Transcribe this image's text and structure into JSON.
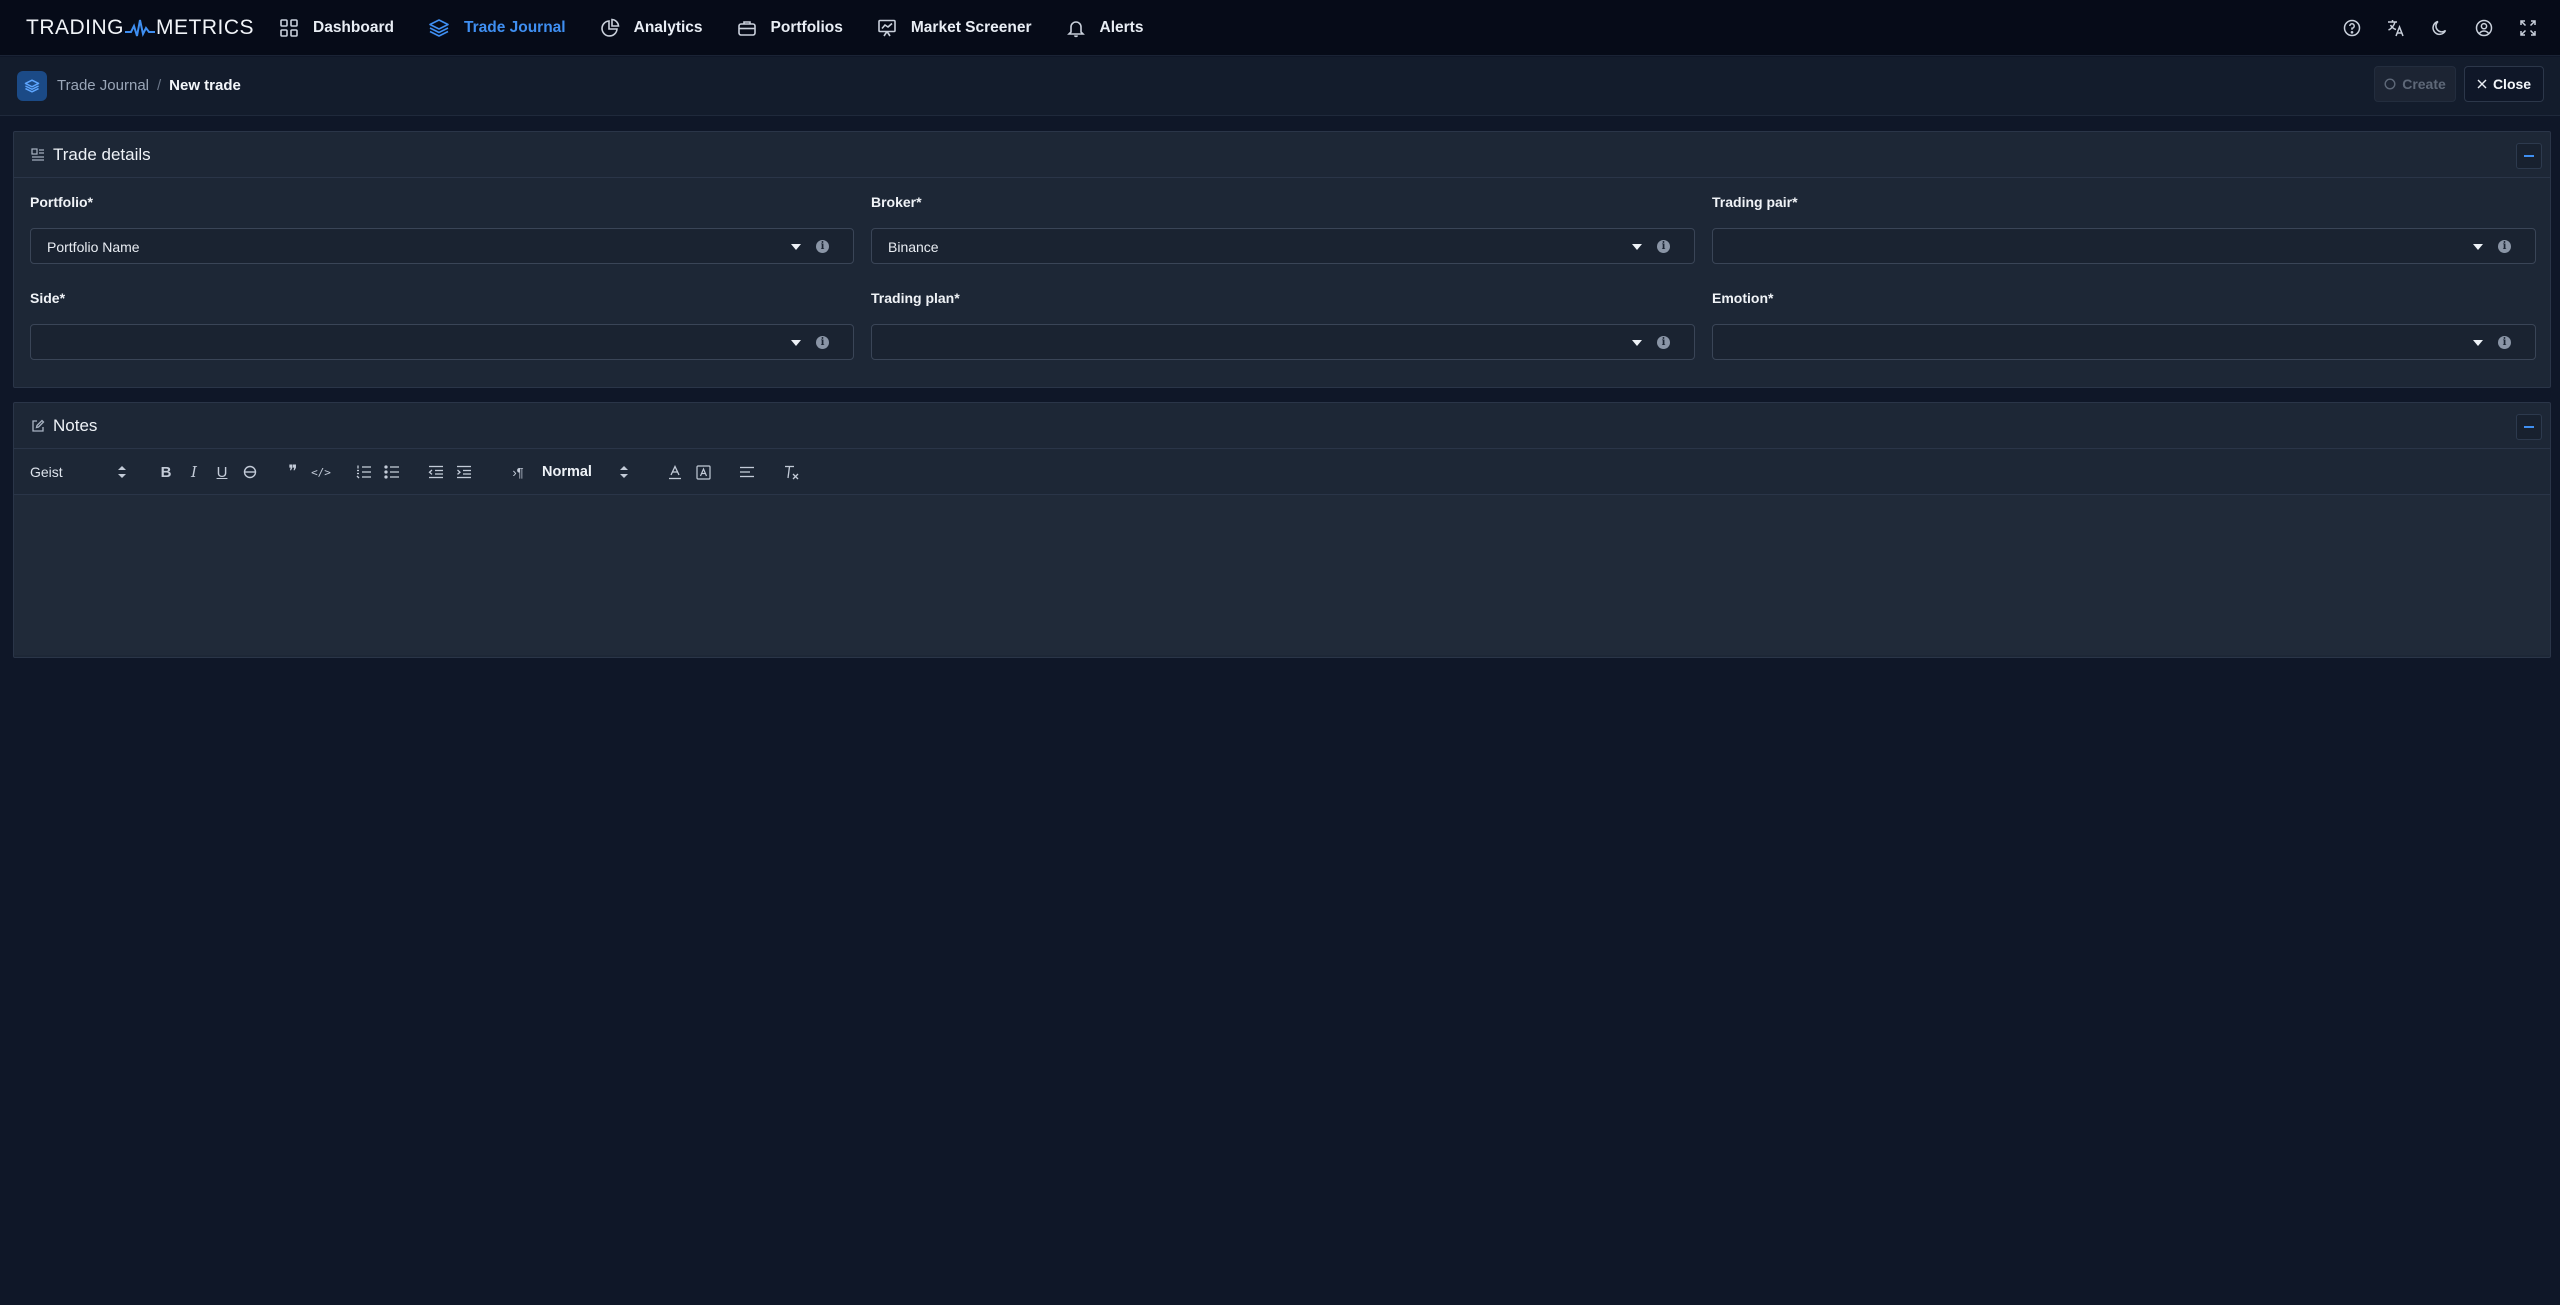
{
  "app": {
    "logo_left": "TRADING",
    "logo_right": "METRICS"
  },
  "nav": {
    "items": [
      {
        "label": "Dashboard",
        "icon": "grid-icon"
      },
      {
        "label": "Trade Journal",
        "icon": "layers-icon",
        "active": true
      },
      {
        "label": "Analytics",
        "icon": "pie-chart-icon"
      },
      {
        "label": "Portfolios",
        "icon": "briefcase-icon"
      },
      {
        "label": "Market Screener",
        "icon": "presentation-chart-icon"
      },
      {
        "label": "Alerts",
        "icon": "bell-icon"
      }
    ],
    "right_icons": [
      "help-icon",
      "translate-icon",
      "moon-icon",
      "user-icon",
      "fullscreen-icon"
    ]
  },
  "breadcrumb": {
    "parent": "Trade Journal",
    "separator": "/",
    "current": "New trade"
  },
  "actions": {
    "create_label": "Create",
    "close_label": "Close"
  },
  "trade_details": {
    "title": "Trade details",
    "fields": {
      "portfolio": {
        "label": "Portfolio*",
        "value": "Portfolio Name"
      },
      "broker": {
        "label": "Broker*",
        "value": "Binance"
      },
      "trading_pair": {
        "label": "Trading pair*",
        "value": ""
      },
      "side": {
        "label": "Side*",
        "value": ""
      },
      "trading_plan": {
        "label": "Trading plan*",
        "value": ""
      },
      "emotion": {
        "label": "Emotion*",
        "value": ""
      }
    }
  },
  "notes": {
    "title": "Notes",
    "toolbar": {
      "font": "Geist",
      "size": "Normal",
      "bold": "B",
      "italic": "I",
      "underline": "U",
      "strike": "S",
      "quote": "❞",
      "code": "</>",
      "align": "≡",
      "clear": "Tx"
    },
    "content": ""
  },
  "colors": {
    "background": "#0f1728",
    "topbar": "#060b18",
    "panel": "#1d2736",
    "accent": "#3f8ff2"
  }
}
